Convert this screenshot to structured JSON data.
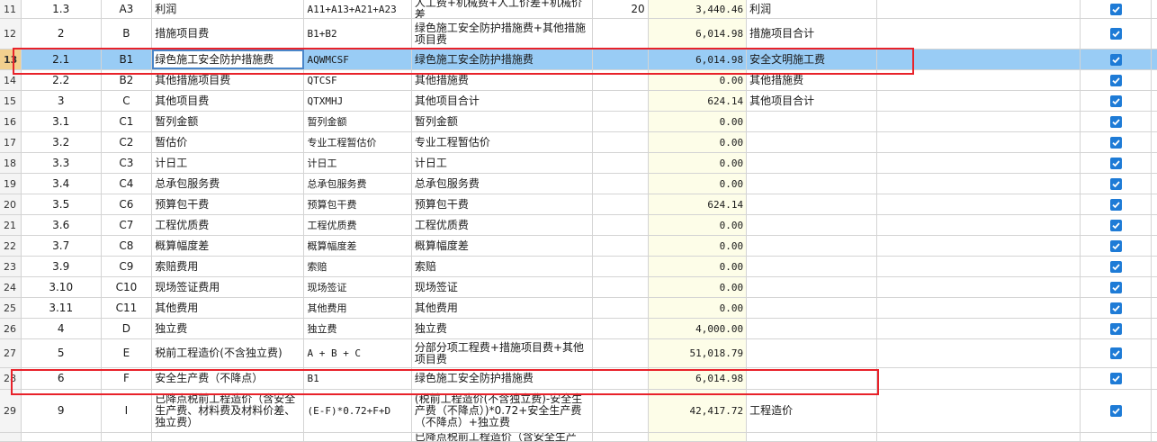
{
  "rows": [
    {
      "idx": "11",
      "num": "1.3",
      "code": "A3",
      "name": "利润",
      "base": "A11+A13+A21+A23",
      "desc": "人工费+机械费+人工价差+机械价差",
      "rate": "20",
      "amount": "3,440.46",
      "category": "利润",
      "checked": true
    },
    {
      "idx": "12",
      "num": "2",
      "code": "B",
      "name": "措施项目费",
      "base": "B1+B2",
      "desc": "绿色施工安全防护措施费+其他措施项目费",
      "rate": "",
      "amount": "6,014.98",
      "category": "措施项目合计",
      "checked": true
    },
    {
      "idx": "13",
      "num": "2.1",
      "code": "B1",
      "name": "绿色施工安全防护措施费",
      "base": "AQWMCSF",
      "desc": "绿色施工安全防护措施费",
      "rate": "",
      "amount": "6,014.98",
      "category": "安全文明施工费",
      "checked": true
    },
    {
      "idx": "14",
      "num": "2.2",
      "code": "B2",
      "name": "其他措施项目费",
      "base": "QTCSF",
      "desc": "其他措施费",
      "rate": "",
      "amount": "0.00",
      "category": "其他措施费",
      "checked": true
    },
    {
      "idx": "15",
      "num": "3",
      "code": "C",
      "name": "其他项目费",
      "base": "QTXMHJ",
      "desc": "其他项目合计",
      "rate": "",
      "amount": "624.14",
      "category": "其他项目合计",
      "checked": true
    },
    {
      "idx": "16",
      "num": "3.1",
      "code": "C1",
      "name": "暂列金额",
      "base": "暂列金额",
      "desc": "暂列金额",
      "rate": "",
      "amount": "0.00",
      "category": "",
      "checked": true
    },
    {
      "idx": "17",
      "num": "3.2",
      "code": "C2",
      "name": "暂估价",
      "base": "专业工程暂估价",
      "desc": "专业工程暂估价",
      "rate": "",
      "amount": "0.00",
      "category": "",
      "checked": true
    },
    {
      "idx": "18",
      "num": "3.3",
      "code": "C3",
      "name": "计日工",
      "base": "计日工",
      "desc": "计日工",
      "rate": "",
      "amount": "0.00",
      "category": "",
      "checked": true
    },
    {
      "idx": "19",
      "num": "3.4",
      "code": "C4",
      "name": "总承包服务费",
      "base": "总承包服务费",
      "desc": "总承包服务费",
      "rate": "",
      "amount": "0.00",
      "category": "",
      "checked": true
    },
    {
      "idx": "20",
      "num": "3.5",
      "code": "C6",
      "name": "预算包干费",
      "base": "预算包干费",
      "desc": "预算包干费",
      "rate": "",
      "amount": "624.14",
      "category": "",
      "checked": true
    },
    {
      "idx": "21",
      "num": "3.6",
      "code": "C7",
      "name": "工程优质费",
      "base": "工程优质费",
      "desc": "工程优质费",
      "rate": "",
      "amount": "0.00",
      "category": "",
      "checked": true
    },
    {
      "idx": "22",
      "num": "3.7",
      "code": "C8",
      "name": "概算幅度差",
      "base": "概算幅度差",
      "desc": "概算幅度差",
      "rate": "",
      "amount": "0.00",
      "category": "",
      "checked": true
    },
    {
      "idx": "23",
      "num": "3.9",
      "code": "C9",
      "name": "索赔费用",
      "base": "索赔",
      "desc": "索赔",
      "rate": "",
      "amount": "0.00",
      "category": "",
      "checked": true
    },
    {
      "idx": "24",
      "num": "3.10",
      "code": "C10",
      "name": "现场签证费用",
      "base": "现场签证",
      "desc": "现场签证",
      "rate": "",
      "amount": "0.00",
      "category": "",
      "checked": true
    },
    {
      "idx": "25",
      "num": "3.11",
      "code": "C11",
      "name": "其他费用",
      "base": "其他费用",
      "desc": "其他费用",
      "rate": "",
      "amount": "0.00",
      "category": "",
      "checked": true
    },
    {
      "idx": "26",
      "num": "4",
      "code": "D",
      "name": "独立费",
      "base": "独立费",
      "desc": "独立费",
      "rate": "",
      "amount": "4,000.00",
      "category": "",
      "checked": true
    },
    {
      "idx": "27",
      "num": "5",
      "code": "E",
      "name": "税前工程造价(不含独立费)",
      "base": "A + B + C",
      "desc": "分部分项工程费+措施项目费+其他项目费",
      "rate": "",
      "amount": "51,018.79",
      "category": "",
      "checked": true
    },
    {
      "idx": "28",
      "num": "6",
      "code": "F",
      "name": "安全生产费（不降点）",
      "base": "B1",
      "desc": "绿色施工安全防护措施费",
      "rate": "",
      "amount": "6,014.98",
      "category": "",
      "checked": true
    },
    {
      "idx": "29",
      "num": "9",
      "code": "I",
      "name": "已降点税前工程造价（含安全生产费、材料费及材料价差、独立费）",
      "base": "(E-F)*0.72+F+D",
      "desc": "(税前工程造价(不含独立费)-安全生产费（不降点）)*0.72+安全生产费（不降点）+独立费",
      "rate": "",
      "amount": "42,417.72",
      "category": "工程造价",
      "checked": true
    },
    {
      "idx": "",
      "num": "",
      "code": "",
      "name": "",
      "base": "",
      "desc": "已降点税前工程造价（含安全生产",
      "rate": "",
      "amount": "",
      "category": "",
      "checked": false
    }
  ],
  "selected_row_idx": "13",
  "colors": {
    "selection": "#99ccf5",
    "highlight_box": "#e8222a",
    "checkbox": "#1e7bd6",
    "amount_bg": "#fdfde8"
  }
}
